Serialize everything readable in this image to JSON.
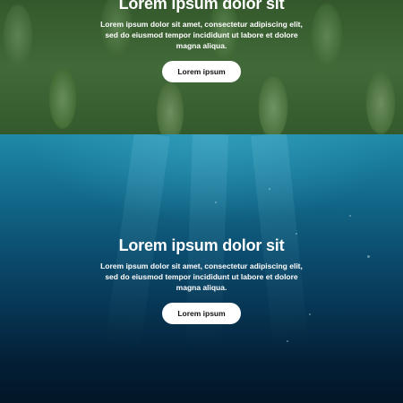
{
  "sections": [
    {
      "id": "leaves",
      "title": "Lorem ipsum dolor sit",
      "body": "Lorem ipsum dolor sit amet, consectetur adipiscing elit, sed do eiusmod tempor incididunt ut labore et dolore magna aliqua.",
      "button_label": "Lorem ipsum"
    },
    {
      "id": "ocean",
      "title": "Lorem ipsum dolor sit",
      "body": "Lorem ipsum dolor sit amet, consectetur adipiscing elit, sed do eiusmod tempor incididunt ut labore et dolore magna aliqua.",
      "button_label": "Lorem ipsum"
    }
  ],
  "colors": {
    "text": "#ffffff",
    "button_bg": "#ffffff",
    "button_text": "#111111",
    "leaf_green": "#4d7c43",
    "ocean_top": "#1f8aa8",
    "ocean_bottom": "#021627"
  }
}
